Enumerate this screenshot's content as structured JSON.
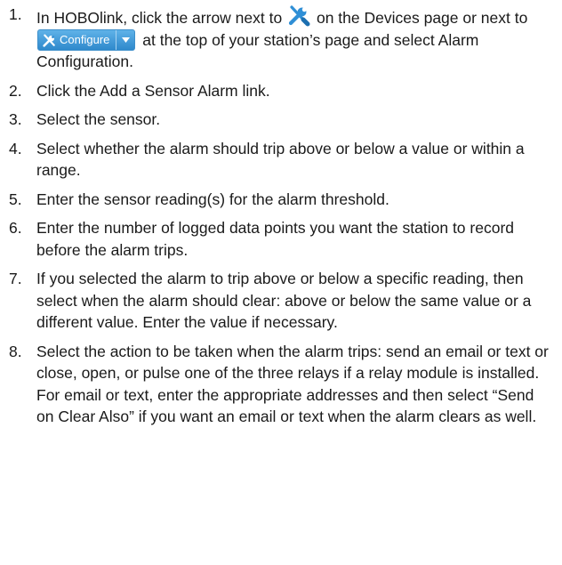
{
  "steps": [
    {
      "num": "1.",
      "text_a": "In HOBOlink, click the arrow next to",
      "text_b": "on the Devices page or next to",
      "text_c": "at the top of your station’s page and select Alarm Configuration."
    },
    {
      "num": "2.",
      "text": "Click the Add a Sensor Alarm link."
    },
    {
      "num": "3.",
      "text": "Select the sensor."
    },
    {
      "num": "4.",
      "text": "Select whether the alarm should trip above or below a value or within a range."
    },
    {
      "num": "5.",
      "text": "Enter the sensor reading(s) for the alarm threshold."
    },
    {
      "num": "6.",
      "text": "Enter the number of logged data points you want the station to record before the alarm trips."
    },
    {
      "num": "7.",
      "text": "If you selected the alarm to trip above or below a specific reading, then select when the alarm should clear: above or below the same value or a different value. Enter the value if necessary."
    },
    {
      "num": "8.",
      "text": "Select the action to be taken when the alarm trips: send an email or text or close, open, or pulse one of the three relays if a relay module is installed. For email or text, enter the appropriate addresses and then select “Send on Clear Also” if you want an email or text when the alarm clears as well."
    }
  ],
  "configure_button": {
    "label": "Configure"
  },
  "icons": {
    "inline_tool": "tools-icon",
    "button_tool": "tools-icon",
    "button_caret": "caret-down-icon"
  },
  "colors": {
    "tool_icon": "#2f8fd6",
    "button_blue": "#3a93d3"
  }
}
